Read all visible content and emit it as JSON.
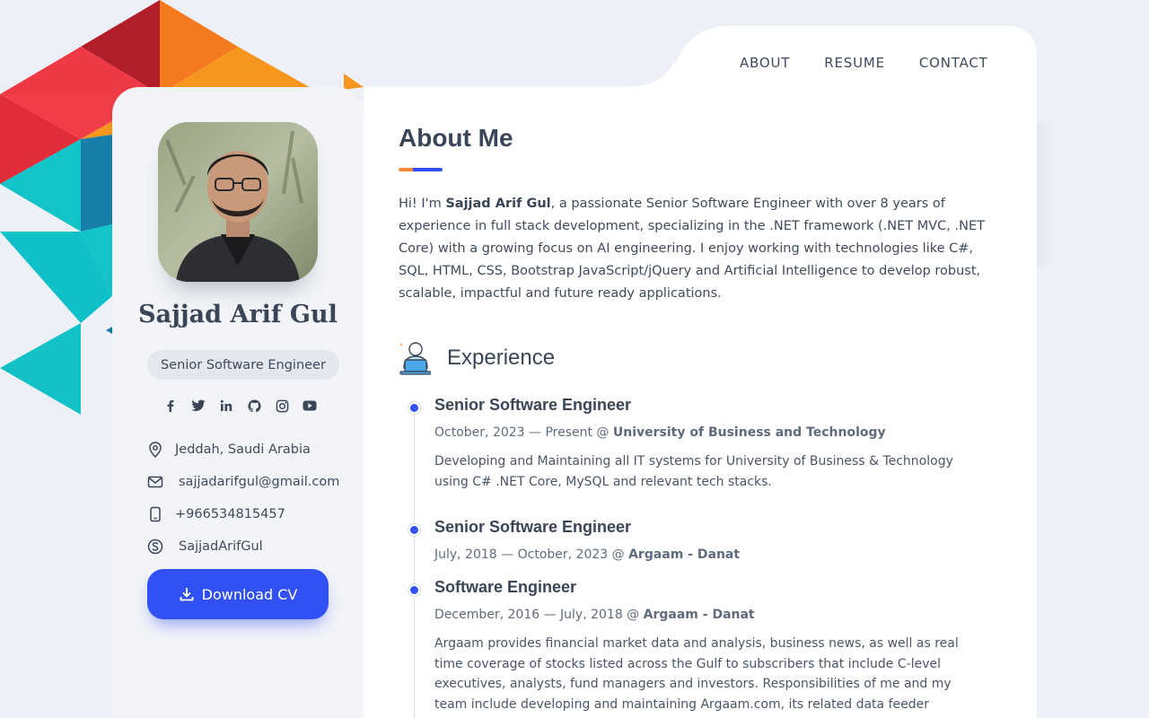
{
  "nav": {
    "items": [
      "ABOUT",
      "RESUME",
      "CONTACT"
    ]
  },
  "profile": {
    "name": "Sajjad Arif Gul",
    "title": "Senior Software Engineer",
    "socials": [
      "facebook-icon",
      "twitter-icon",
      "linkedin-icon",
      "github-icon",
      "instagram-icon",
      "youtube-icon"
    ],
    "location": "Jeddah, Saudi Arabia",
    "email": "sajjadarifgul@gmail.com",
    "phone": "+966534815457",
    "skype": "SajjadArifGul",
    "download_label": "Download CV"
  },
  "about": {
    "heading": "About Me",
    "intro_prefix": "Hi! I'm ",
    "intro_name": "Sajjad Arif Gul",
    "intro_rest": ", a passionate Senior Software Engineer with over 8 years of experience in full stack development, specializing in the .NET framework (.NET MVC, .NET Core) with a growing focus on AI engineering. I enjoy working with technologies like C#, SQL, HTML, CSS, Bootstrap JavaScript/jQuery and Artificial Intelligence to develop robust, scalable, impactful and future ready applications."
  },
  "experience": {
    "heading": "Experience",
    "jobs": [
      {
        "title": "Senior Software Engineer",
        "dates": "October, 2023 — Present @ ",
        "company": "University of Business and Technology",
        "description": "Developing and Maintaining all IT systems for University of Business & Technology using C# .NET Core, MySQL and relevant tech stacks."
      },
      {
        "title": "Senior Software Engineer",
        "dates": "July, 2018 — October, 2023 @ ",
        "company": "Argaam - Danat",
        "description": ""
      },
      {
        "title": "Software Engineer",
        "dates": "December, 2016 — July, 2018 @ ",
        "company": "Argaam - Danat",
        "description": "Argaam provides financial market data and analysis, business news, as well as real time coverage of stocks listed across the Gulf to subscribers that include C-level executives, analysts, fund managers and investors. Responsibilities of me and my team include developing and maintaining Argaam.com, its related data feeder services, its subsidiaries websites and"
      }
    ]
  },
  "colors": {
    "accent": "#3150f5",
    "orange": "#f58b3a",
    "teal": "#0fc0c8",
    "red": "#e83a44"
  }
}
